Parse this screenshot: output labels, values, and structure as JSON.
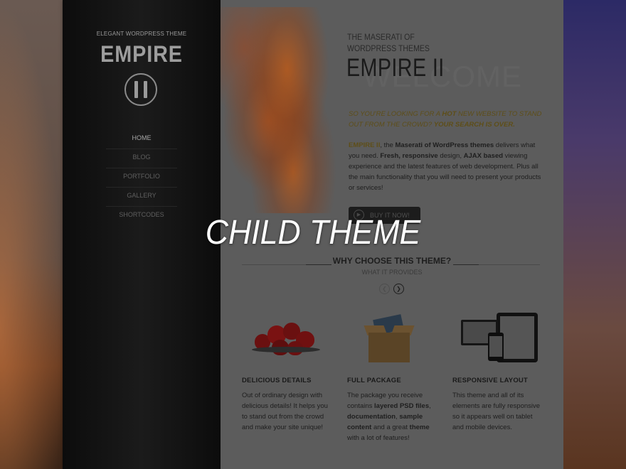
{
  "sidebar": {
    "tagline": "ELEGANT WORDPRESS THEME",
    "logo": "EMPIRE",
    "nav": [
      {
        "label": "HOME",
        "active": true
      },
      {
        "label": "BLOG"
      },
      {
        "label": "PORTFOLIO"
      },
      {
        "label": "GALLERY"
      },
      {
        "label": "SHORTCODES"
      }
    ]
  },
  "hero": {
    "line1": "THE MASERATI OF",
    "line2": "WORDPRESS THEMES",
    "title": "EMPIRE II",
    "ghost": "WELCOME",
    "tagline_pre": "SO YOU'RE LOOKING FOR A ",
    "tagline_hot": "HOT",
    "tagline_mid": " NEW WEBSITE TO STAND OUT FROM THE CROWD? ",
    "tagline_end": "YOUR SEARCH IS OVER.",
    "desc_brand": "EMPIRE II",
    "desc_1": ", the ",
    "desc_bold1": "Maserati of WordPress themes",
    "desc_2": " delivers what you need. ",
    "desc_bold2": "Fresh, responsive",
    "desc_3": " design, ",
    "desc_bold3": "AJAX based",
    "desc_4": " viewing experience and the latest features of web development. Plus all the main functionality that you will need to present your products or services!",
    "buy_label": "BUY IT NOW!"
  },
  "section": {
    "title": "WHY CHOOSE THIS THEME?",
    "subtitle": "WHAT IT PROVIDES"
  },
  "features": [
    {
      "title": "DELICIOUS DETAILS",
      "text": "Out of ordinary design with delicious details! It helps you to stand out from the crowd and make your site unique!"
    },
    {
      "title": "FULL PACKAGE",
      "text_1": "The package you receive contains ",
      "bold_1": "layered PSD files",
      "text_2": ", ",
      "bold_2": "documentation",
      "text_3": ", ",
      "bold_3": "sample content",
      "text_4": " and a great ",
      "bold_4": "theme",
      "text_5": " with a lot of features!"
    },
    {
      "title": "RESPONSIVE LAYOUT",
      "text": "This theme and all of its elements are fully responsive so it appears well on tablet and mobile devices."
    }
  ],
  "overlay": {
    "title": "CHILD THEME"
  },
  "colors": {
    "sidebar_bg": "#111111",
    "content_bg": "#5c5c5c",
    "accent_gold": "#5e4e18"
  }
}
